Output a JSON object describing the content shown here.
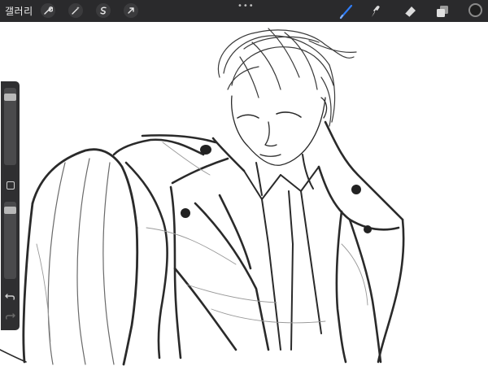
{
  "toolbar": {
    "gallery_label": "갤러리",
    "left_tools": [
      "wrench-icon",
      "magic-wand-icon",
      "selection-icon",
      "transform-arrow-icon"
    ],
    "more_label": "•••",
    "right_tools": [
      "brush-icon",
      "smudge-icon",
      "eraser-icon",
      "layers-icon"
    ],
    "active_tool": "brush-icon",
    "active_color": "#1f1f1f",
    "accent_color": "#2f7cf6"
  },
  "sidebar": {
    "brush_size_level": 0.08,
    "opacity_level": 0.02,
    "controls": [
      "modify-button",
      "undo-button",
      "redo-button"
    ]
  }
}
